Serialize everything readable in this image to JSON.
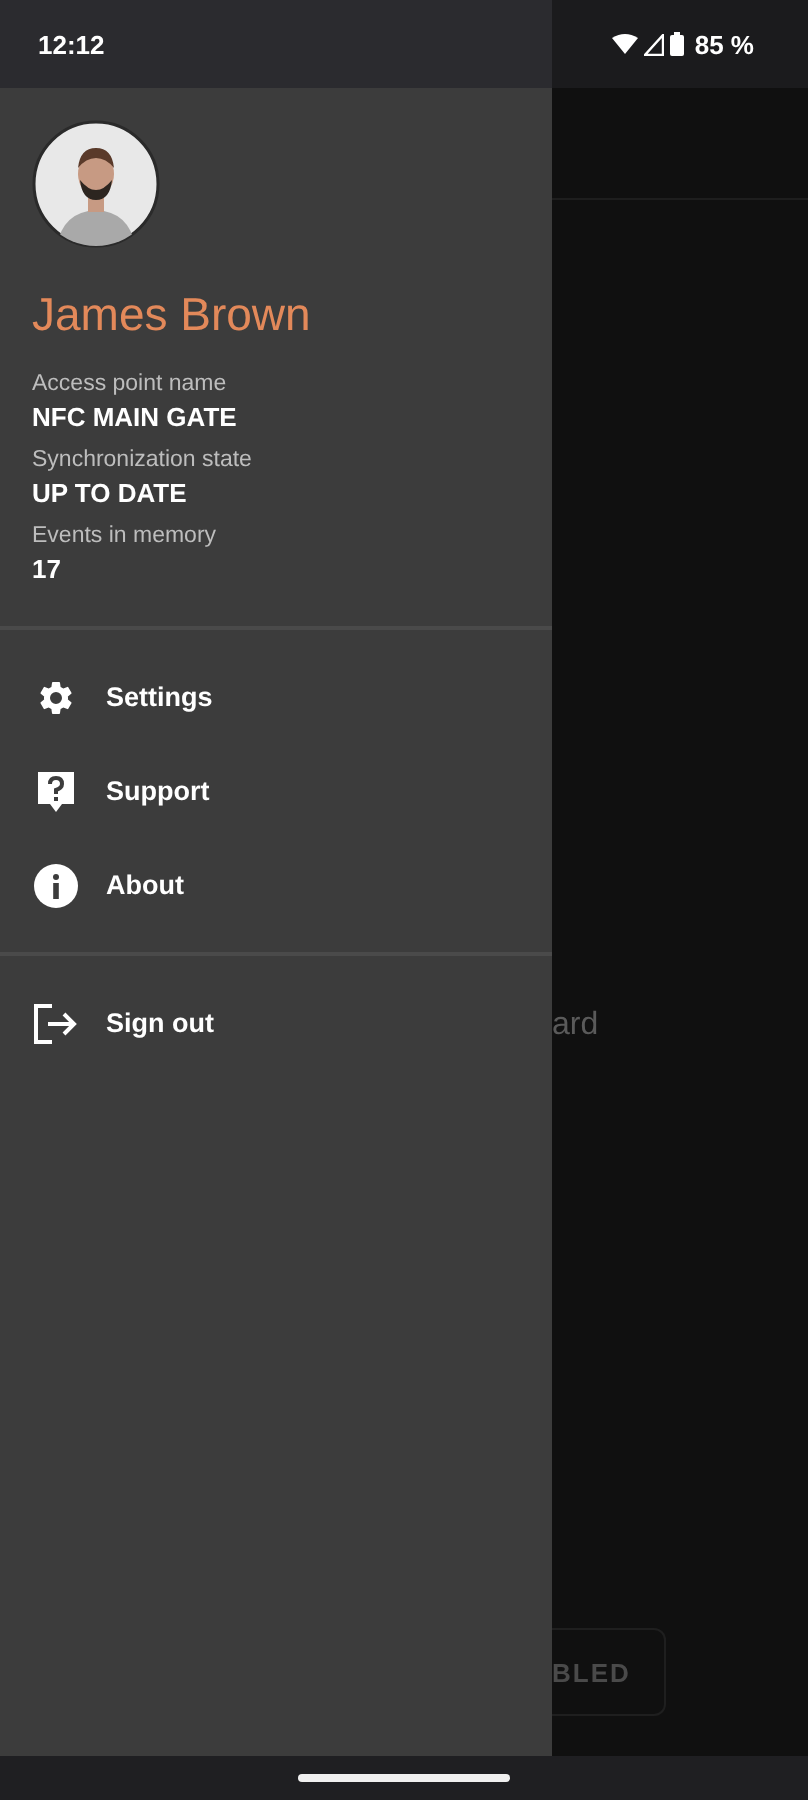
{
  "status_bar": {
    "time": "12:12",
    "battery": "85 %"
  },
  "drawer": {
    "user_name": "James Brown",
    "info": [
      {
        "label": "Access point name",
        "value": "NFC MAIN GATE"
      },
      {
        "label": "Synchronization state",
        "value": "UP TO DATE"
      },
      {
        "label": "Events in memory",
        "value": "17"
      }
    ],
    "menu": [
      {
        "kind": "settings",
        "label": "Settings"
      },
      {
        "kind": "support",
        "label": "Support"
      },
      {
        "kind": "about",
        "label": "About"
      }
    ],
    "footer_menu": [
      {
        "kind": "sign-out",
        "label": "Sign out"
      }
    ]
  },
  "background": {
    "text": "ard",
    "button": "BLED"
  }
}
